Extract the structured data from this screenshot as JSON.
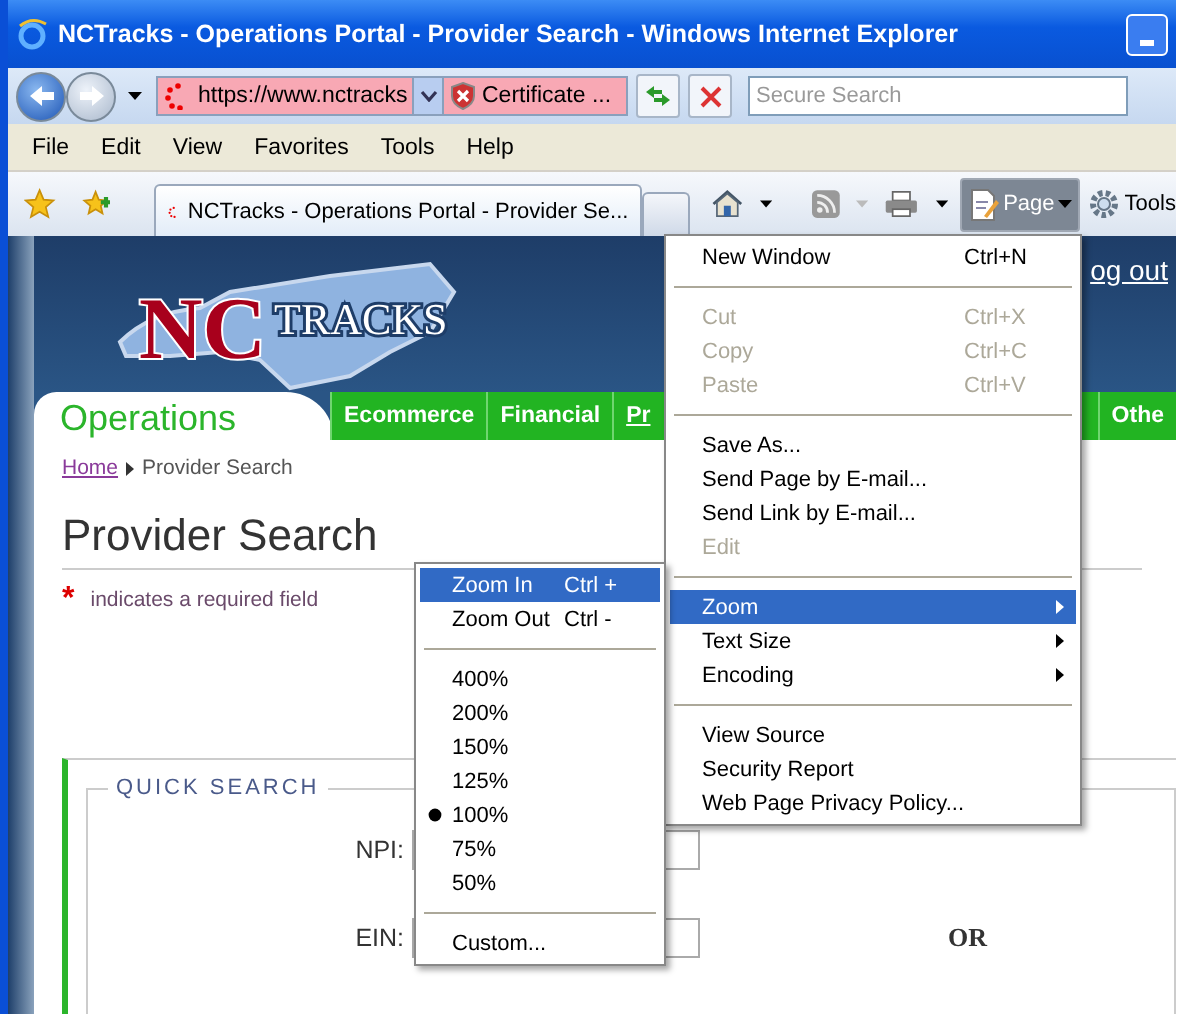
{
  "window": {
    "title": "NCTracks - Operations Portal - Provider Search - Windows Internet Explorer"
  },
  "address_bar": {
    "url": "https://www.nctracks",
    "certificate": "Certificate ...",
    "search_placeholder": "Secure Search"
  },
  "menu_bar": [
    "File",
    "Edit",
    "View",
    "Favorites",
    "Tools",
    "Help"
  ],
  "tabs": [
    {
      "label": "NCTracks - Operations Portal - Provider Se...",
      "selected": true
    }
  ],
  "command_bar": {
    "page": "Page",
    "tools": "Tools"
  },
  "page": {
    "logo": {
      "first": "NC",
      "second": "TRACKS"
    },
    "logout": "og out",
    "nav": {
      "section": "Operations",
      "tabs": [
        "Ecommerce",
        "Financial",
        "Pr",
        "Othe"
      ]
    },
    "breadcrumb": {
      "home": "Home",
      "current": "Provider Search"
    },
    "heading": "Provider Search",
    "required_note": {
      "mark": "*",
      "text": "indicates a required field"
    },
    "quick_search": {
      "legend": "QUICK SEARCH",
      "fields": [
        {
          "label": "NPI:"
        },
        {
          "label": "EIN:"
        }
      ],
      "or": "OR"
    }
  },
  "page_menu": [
    {
      "kind": "item",
      "label": "New Window",
      "shortcut": "Ctrl+N",
      "disabled": false,
      "selected": false,
      "submenu": false
    },
    {
      "kind": "separator"
    },
    {
      "kind": "item",
      "label": "Cut",
      "shortcut": "Ctrl+X",
      "disabled": true,
      "selected": false,
      "submenu": false
    },
    {
      "kind": "item",
      "label": "Copy",
      "shortcut": "Ctrl+C",
      "disabled": true,
      "selected": false,
      "submenu": false
    },
    {
      "kind": "item",
      "label": "Paste",
      "shortcut": "Ctrl+V",
      "disabled": true,
      "selected": false,
      "submenu": false
    },
    {
      "kind": "separator"
    },
    {
      "kind": "item",
      "label": "Save As...",
      "disabled": false,
      "selected": false,
      "submenu": false
    },
    {
      "kind": "item",
      "label": "Send Page by E-mail...",
      "disabled": false,
      "selected": false,
      "submenu": false
    },
    {
      "kind": "item",
      "label": "Send Link by E-mail...",
      "disabled": false,
      "selected": false,
      "submenu": false
    },
    {
      "kind": "item",
      "label": "Edit",
      "disabled": true,
      "selected": false,
      "submenu": false
    },
    {
      "kind": "separator"
    },
    {
      "kind": "item",
      "label": "Zoom",
      "disabled": false,
      "selected": true,
      "submenu": true
    },
    {
      "kind": "item",
      "label": "Text Size",
      "disabled": false,
      "selected": false,
      "submenu": true
    },
    {
      "kind": "item",
      "label": "Encoding",
      "disabled": false,
      "selected": false,
      "submenu": true
    },
    {
      "kind": "separator"
    },
    {
      "kind": "item",
      "label": "View Source",
      "disabled": false,
      "selected": false,
      "submenu": false
    },
    {
      "kind": "item",
      "label": "Security Report",
      "disabled": false,
      "selected": false,
      "submenu": false
    },
    {
      "kind": "item",
      "label": "Web Page Privacy Policy...",
      "disabled": false,
      "selected": false,
      "submenu": false
    }
  ],
  "zoom_menu": [
    {
      "kind": "item",
      "label": "Zoom In",
      "shortcut": "Ctrl +",
      "selected": true,
      "checked": false
    },
    {
      "kind": "item",
      "label": "Zoom Out",
      "shortcut": "Ctrl -",
      "selected": false,
      "checked": false
    },
    {
      "kind": "separator"
    },
    {
      "kind": "item",
      "label": "400%",
      "selected": false,
      "checked": false
    },
    {
      "kind": "item",
      "label": "200%",
      "selected": false,
      "checked": false
    },
    {
      "kind": "item",
      "label": "150%",
      "selected": false,
      "checked": false
    },
    {
      "kind": "item",
      "label": "125%",
      "selected": false,
      "checked": false
    },
    {
      "kind": "item",
      "label": "100%",
      "selected": false,
      "checked": true
    },
    {
      "kind": "item",
      "label": "75%",
      "selected": false,
      "checked": false
    },
    {
      "kind": "item",
      "label": "50%",
      "selected": false,
      "checked": false
    },
    {
      "kind": "separator"
    },
    {
      "kind": "item",
      "label": "Custom...",
      "selected": false,
      "checked": false
    }
  ]
}
